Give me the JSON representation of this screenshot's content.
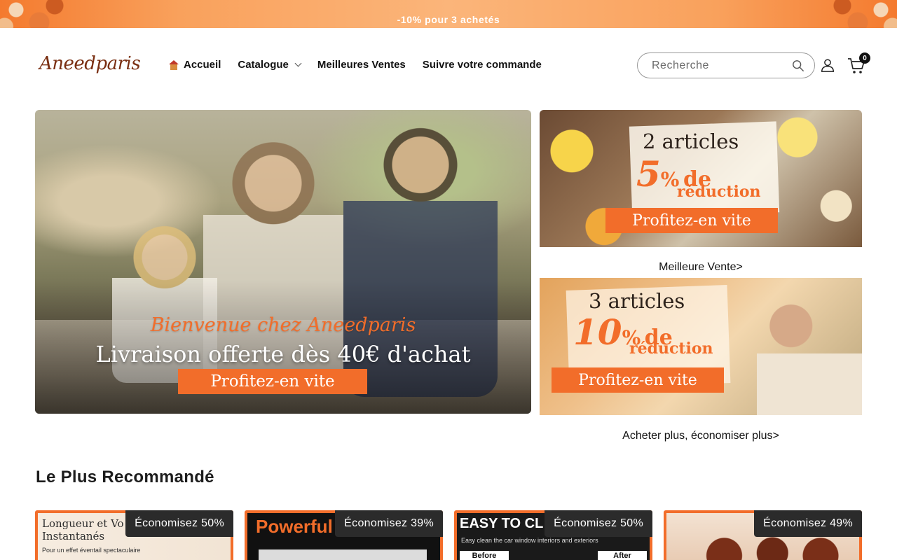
{
  "announcement": {
    "text": "-10% pour 3 achetés"
  },
  "header": {
    "logo": "Aneedparis",
    "nav": [
      {
        "label": "Accueil",
        "icon": "home-icon"
      },
      {
        "label": "Catalogue",
        "icon": "chevron-down-icon"
      },
      {
        "label": "Meilleures Ventes"
      },
      {
        "label": "Suivre votre commande"
      }
    ],
    "search": {
      "placeholder": "Recherche",
      "value": ""
    },
    "cart_count": "0"
  },
  "hero": {
    "welcome": "Bienvenue chez Aneedparis",
    "title": "Livraison offerte dès 40€ d'achat",
    "cta": "Profitez-en vite"
  },
  "promos": [
    {
      "line1": "2 articles",
      "big": "5",
      "pct": "%",
      "de": "de",
      "line3": "réduction",
      "cta": "Profitez-en vite",
      "link": "Meilleure Vente>"
    },
    {
      "line1": "3 articles",
      "big": "10",
      "pct": "%",
      "de": "de",
      "line3": "réduction",
      "cta": "Profitez-en vite",
      "link": "Acheter plus, économiser plus>"
    }
  ],
  "section": {
    "title": "Le Plus Recommandé"
  },
  "products": [
    {
      "badge": "Économisez 50%",
      "text1": "Longueur et Vo",
      "text2": "Instantanés",
      "sub": "Pour un effet éventail spectaculaire"
    },
    {
      "badge": "Économisez 39%",
      "text1": "Powerful"
    },
    {
      "badge": "Économisez 50%",
      "text1": "EASY TO CL",
      "sub": "Easy clean the car window interiors and exteriors",
      "before": "Before",
      "after": "After"
    },
    {
      "badge": "Économisez 49%"
    }
  ],
  "colors": {
    "accent": "#f26d2a",
    "text": "#121212",
    "badge": "#2b2b2b"
  }
}
